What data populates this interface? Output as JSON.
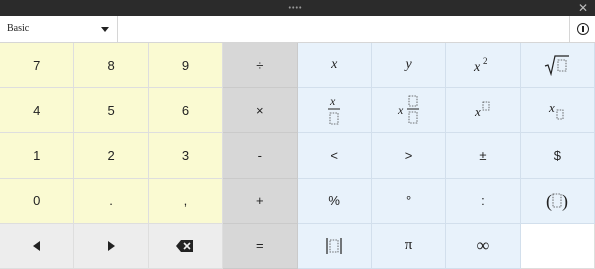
{
  "title_bar": {
    "close_glyph": "✕"
  },
  "mode_selector": {
    "selected": "Basic"
  },
  "keys": {
    "row1": [
      "7",
      "8",
      "9",
      "÷"
    ],
    "row2": [
      "4",
      "5",
      "6",
      "×"
    ],
    "row3": [
      "1",
      "2",
      "3",
      "-"
    ],
    "row4": [
      "0",
      ".",
      ",",
      "+"
    ],
    "row5_ops": [
      "="
    ],
    "fn_row1": [
      "x",
      "y"
    ],
    "fn_row3": [
      "<",
      ">",
      "±",
      "$"
    ],
    "fn_row4": [
      "%",
      "°",
      ":"
    ],
    "fn_row5": [
      "π",
      "∞"
    ]
  },
  "icons": {
    "info": "info-icon",
    "left": "arrow-left-icon",
    "right": "arrow-right-icon",
    "backspace": "backspace-icon",
    "square": "x-squared-icon",
    "sqrt": "square-root-icon",
    "fraction": "fraction-icon",
    "mixed": "mixed-fraction-icon",
    "power": "power-icon",
    "subscript": "subscript-icon",
    "parens": "parentheses-icon",
    "abs": "absolute-value-icon"
  }
}
